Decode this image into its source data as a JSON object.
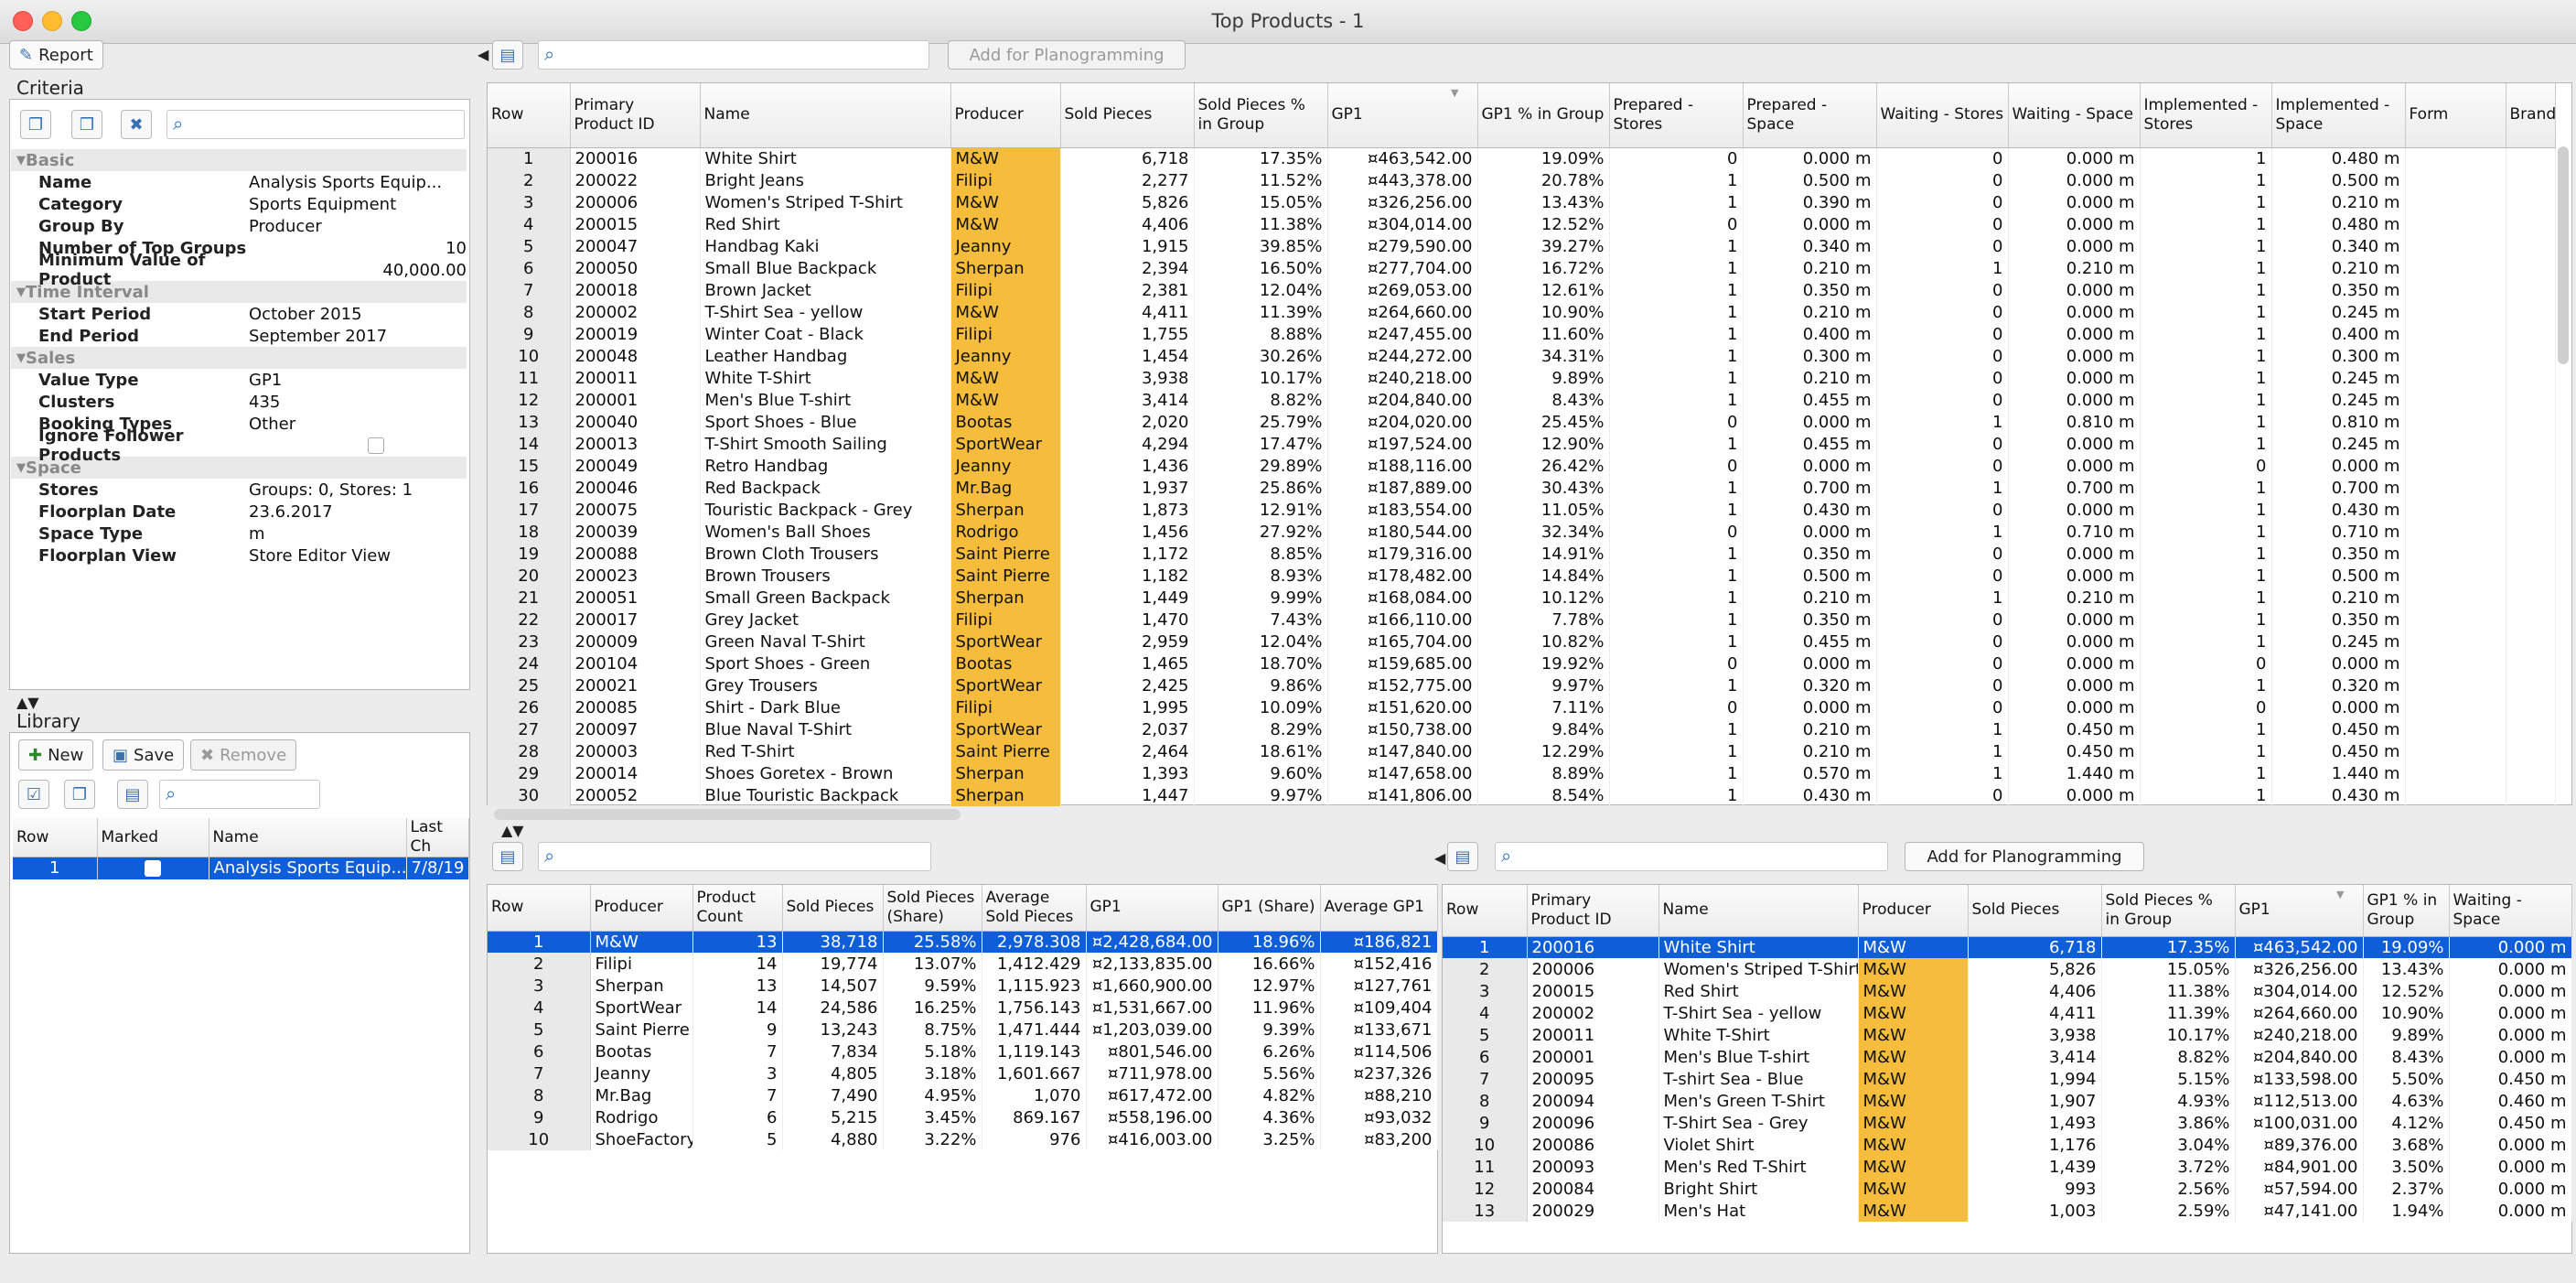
{
  "window": {
    "title": "Top Products - 1"
  },
  "toolbar": {
    "report": "Report"
  },
  "criteria": {
    "title": "Criteria",
    "groups": [
      {
        "name": "Basic",
        "rows": [
          [
            "Name",
            "Analysis Sports Equip..."
          ],
          [
            "Category",
            "Sports Equipment"
          ],
          [
            "Group By",
            "Producer"
          ],
          [
            "Number of Top Groups",
            "10"
          ],
          [
            "Minimum Value of Product",
            "40,000.00"
          ]
        ]
      },
      {
        "name": "Time Interval",
        "rows": [
          [
            "Start Period",
            "October 2015"
          ],
          [
            "End Period",
            "September 2017"
          ]
        ]
      },
      {
        "name": "Sales",
        "rows": [
          [
            "Value Type",
            "GP1"
          ],
          [
            "Clusters",
            "435"
          ],
          [
            "Booking Types",
            "Other"
          ],
          [
            "Ignore Follower Products",
            ""
          ]
        ]
      },
      {
        "name": "Space",
        "rows": [
          [
            "Stores",
            "Groups: 0, Stores: 1"
          ],
          [
            "Floorplan Date",
            "23.6.2017"
          ],
          [
            "Space Type",
            "m"
          ],
          [
            "Floorplan View",
            "Store Editor View"
          ]
        ]
      }
    ]
  },
  "library": {
    "title": "Library",
    "new": "New",
    "save": "Save",
    "remove": "Remove",
    "headers": [
      "Row",
      "Marked",
      "Name",
      "Last Ch"
    ],
    "rows": [
      [
        "1",
        "",
        "Analysis Sports Equip...",
        "7/8/19"
      ]
    ]
  },
  "main": {
    "add_button": "Add for Planogramming",
    "sort_indicator": "1",
    "headers": [
      "Row",
      "Primary Product ID",
      "Name",
      "Producer",
      "Sold Pieces",
      "Sold Pieces % in Group",
      "GP1",
      "GP1 % in Group",
      "Prepared - Stores",
      "Prepared - Space",
      "Waiting - Stores",
      "Waiting - Space",
      "Implemented - Stores",
      "Implemented - Space",
      "Form",
      "Brand"
    ],
    "rows": [
      [
        "1",
        "200016",
        "White Shirt",
        "M&W",
        "6,718",
        "17.35%",
        "¤463,542.00",
        "19.09%",
        "0",
        "0.000 m",
        "0",
        "0.000 m",
        "1",
        "0.480 m"
      ],
      [
        "2",
        "200022",
        "Bright Jeans",
        "Filipi",
        "2,277",
        "11.52%",
        "¤443,378.00",
        "20.78%",
        "1",
        "0.500 m",
        "0",
        "0.000 m",
        "1",
        "0.500 m"
      ],
      [
        "3",
        "200006",
        "Women's Striped T-Shirt",
        "M&W",
        "5,826",
        "15.05%",
        "¤326,256.00",
        "13.43%",
        "1",
        "0.390 m",
        "0",
        "0.000 m",
        "1",
        "0.210 m"
      ],
      [
        "4",
        "200015",
        "Red Shirt",
        "M&W",
        "4,406",
        "11.38%",
        "¤304,014.00",
        "12.52%",
        "0",
        "0.000 m",
        "0",
        "0.000 m",
        "1",
        "0.480 m"
      ],
      [
        "5",
        "200047",
        "Handbag Kaki",
        "Jeanny",
        "1,915",
        "39.85%",
        "¤279,590.00",
        "39.27%",
        "1",
        "0.340 m",
        "0",
        "0.000 m",
        "1",
        "0.340 m"
      ],
      [
        "6",
        "200050",
        "Small Blue Backpack",
        "Sherpan",
        "2,394",
        "16.50%",
        "¤277,704.00",
        "16.72%",
        "1",
        "0.210 m",
        "1",
        "0.210 m",
        "1",
        "0.210 m"
      ],
      [
        "7",
        "200018",
        "Brown Jacket",
        "Filipi",
        "2,381",
        "12.04%",
        "¤269,053.00",
        "12.61%",
        "1",
        "0.350 m",
        "0",
        "0.000 m",
        "1",
        "0.350 m"
      ],
      [
        "8",
        "200002",
        "T-Shirt Sea - yellow",
        "M&W",
        "4,411",
        "11.39%",
        "¤264,660.00",
        "10.90%",
        "1",
        "0.210 m",
        "0",
        "0.000 m",
        "1",
        "0.245 m"
      ],
      [
        "9",
        "200019",
        "Winter Coat - Black",
        "Filipi",
        "1,755",
        "8.88%",
        "¤247,455.00",
        "11.60%",
        "1",
        "0.400 m",
        "0",
        "0.000 m",
        "1",
        "0.400 m"
      ],
      [
        "10",
        "200048",
        "Leather Handbag",
        "Jeanny",
        "1,454",
        "30.26%",
        "¤244,272.00",
        "34.31%",
        "1",
        "0.300 m",
        "0",
        "0.000 m",
        "1",
        "0.300 m"
      ],
      [
        "11",
        "200011",
        "White T-Shirt",
        "M&W",
        "3,938",
        "10.17%",
        "¤240,218.00",
        "9.89%",
        "1",
        "0.210 m",
        "0",
        "0.000 m",
        "1",
        "0.245 m"
      ],
      [
        "12",
        "200001",
        "Men's Blue T-shirt",
        "M&W",
        "3,414",
        "8.82%",
        "¤204,840.00",
        "8.43%",
        "1",
        "0.455 m",
        "0",
        "0.000 m",
        "1",
        "0.245 m"
      ],
      [
        "13",
        "200040",
        "Sport Shoes - Blue",
        "Bootas",
        "2,020",
        "25.79%",
        "¤204,020.00",
        "25.45%",
        "0",
        "0.000 m",
        "1",
        "0.810 m",
        "1",
        "0.810 m"
      ],
      [
        "14",
        "200013",
        "T-Shirt Smooth Sailing",
        "SportWear",
        "4,294",
        "17.47%",
        "¤197,524.00",
        "12.90%",
        "1",
        "0.455 m",
        "0",
        "0.000 m",
        "1",
        "0.245 m"
      ],
      [
        "15",
        "200049",
        "Retro Handbag",
        "Jeanny",
        "1,436",
        "29.89%",
        "¤188,116.00",
        "26.42%",
        "0",
        "0.000 m",
        "0",
        "0.000 m",
        "0",
        "0.000 m"
      ],
      [
        "16",
        "200046",
        "Red Backpack",
        "Mr.Bag",
        "1,937",
        "25.86%",
        "¤187,889.00",
        "30.43%",
        "1",
        "0.700 m",
        "1",
        "0.700 m",
        "1",
        "0.700 m"
      ],
      [
        "17",
        "200075",
        "Touristic Backpack - Grey",
        "Sherpan",
        "1,873",
        "12.91%",
        "¤183,554.00",
        "11.05%",
        "1",
        "0.430 m",
        "0",
        "0.000 m",
        "1",
        "0.430 m"
      ],
      [
        "18",
        "200039",
        "Women's Ball Shoes",
        "Rodrigo",
        "1,456",
        "27.92%",
        "¤180,544.00",
        "32.34%",
        "0",
        "0.000 m",
        "1",
        "0.710 m",
        "1",
        "0.710 m"
      ],
      [
        "19",
        "200088",
        "Brown Cloth Trousers",
        "Saint Pierre",
        "1,172",
        "8.85%",
        "¤179,316.00",
        "14.91%",
        "1",
        "0.350 m",
        "0",
        "0.000 m",
        "1",
        "0.350 m"
      ],
      [
        "20",
        "200023",
        "Brown Trousers",
        "Saint Pierre",
        "1,182",
        "8.93%",
        "¤178,482.00",
        "14.84%",
        "1",
        "0.500 m",
        "0",
        "0.000 m",
        "1",
        "0.500 m"
      ],
      [
        "21",
        "200051",
        "Small Green Backpack",
        "Sherpan",
        "1,449",
        "9.99%",
        "¤168,084.00",
        "10.12%",
        "1",
        "0.210 m",
        "1",
        "0.210 m",
        "1",
        "0.210 m"
      ],
      [
        "22",
        "200017",
        "Grey Jacket",
        "Filipi",
        "1,470",
        "7.43%",
        "¤166,110.00",
        "7.78%",
        "1",
        "0.350 m",
        "0",
        "0.000 m",
        "1",
        "0.350 m"
      ],
      [
        "23",
        "200009",
        "Green Naval T-Shirt",
        "SportWear",
        "2,959",
        "12.04%",
        "¤165,704.00",
        "10.82%",
        "1",
        "0.455 m",
        "0",
        "0.000 m",
        "1",
        "0.245 m"
      ],
      [
        "24",
        "200104",
        "Sport Shoes - Green",
        "Bootas",
        "1,465",
        "18.70%",
        "¤159,685.00",
        "19.92%",
        "0",
        "0.000 m",
        "0",
        "0.000 m",
        "0",
        "0.000 m"
      ],
      [
        "25",
        "200021",
        "Grey Trousers",
        "SportWear",
        "2,425",
        "9.86%",
        "¤152,775.00",
        "9.97%",
        "1",
        "0.320 m",
        "0",
        "0.000 m",
        "1",
        "0.320 m"
      ],
      [
        "26",
        "200085",
        "Shirt - Dark Blue",
        "Filipi",
        "1,995",
        "10.09%",
        "¤151,620.00",
        "7.11%",
        "0",
        "0.000 m",
        "0",
        "0.000 m",
        "0",
        "0.000 m"
      ],
      [
        "27",
        "200097",
        "Blue Naval T-Shirt",
        "SportWear",
        "2,037",
        "8.29%",
        "¤150,738.00",
        "9.84%",
        "1",
        "0.210 m",
        "1",
        "0.450 m",
        "1",
        "0.450 m"
      ],
      [
        "28",
        "200003",
        "Red T-Shirt",
        "Saint Pierre",
        "2,464",
        "18.61%",
        "¤147,840.00",
        "12.29%",
        "1",
        "0.210 m",
        "1",
        "0.450 m",
        "1",
        "0.450 m"
      ],
      [
        "29",
        "200014",
        "Shoes Goretex - Brown",
        "Sherpan",
        "1,393",
        "9.60%",
        "¤147,658.00",
        "8.89%",
        "1",
        "0.570 m",
        "1",
        "1.440 m",
        "1",
        "1.440 m"
      ],
      [
        "30",
        "200052",
        "Blue Touristic Backpack",
        "Sherpan",
        "1,447",
        "9.97%",
        "¤141,806.00",
        "8.54%",
        "1",
        "0.430 m",
        "0",
        "0.000 m",
        "1",
        "0.430 m"
      ]
    ]
  },
  "groups": {
    "headers": [
      "Row",
      "Producer",
      "Product Count",
      "Sold Pieces",
      "Sold Pieces (Share)",
      "Average Sold Pieces",
      "GP1",
      "GP1 (Share)",
      "Average GP1"
    ],
    "rows": [
      [
        "1",
        "M&W",
        "13",
        "38,718",
        "25.58%",
        "2,978.308",
        "¤2,428,684.00",
        "18.96%",
        "¤186,821"
      ],
      [
        "2",
        "Filipi",
        "14",
        "19,774",
        "13.07%",
        "1,412.429",
        "¤2,133,835.00",
        "16.66%",
        "¤152,416"
      ],
      [
        "3",
        "Sherpan",
        "13",
        "14,507",
        "9.59%",
        "1,115.923",
        "¤1,660,900.00",
        "12.97%",
        "¤127,761"
      ],
      [
        "4",
        "SportWear",
        "14",
        "24,586",
        "16.25%",
        "1,756.143",
        "¤1,531,667.00",
        "11.96%",
        "¤109,404"
      ],
      [
        "5",
        "Saint Pierre",
        "9",
        "13,243",
        "8.75%",
        "1,471.444",
        "¤1,203,039.00",
        "9.39%",
        "¤133,671"
      ],
      [
        "6",
        "Bootas",
        "7",
        "7,834",
        "5.18%",
        "1,119.143",
        "¤801,546.00",
        "6.26%",
        "¤114,506"
      ],
      [
        "7",
        "Jeanny",
        "3",
        "4,805",
        "3.18%",
        "1,601.667",
        "¤711,978.00",
        "5.56%",
        "¤237,326"
      ],
      [
        "8",
        "Mr.Bag",
        "7",
        "7,490",
        "4.95%",
        "1,070",
        "¤617,472.00",
        "4.82%",
        "¤88,210"
      ],
      [
        "9",
        "Rodrigo",
        "6",
        "5,215",
        "3.45%",
        "869.167",
        "¤558,196.00",
        "4.36%",
        "¤93,032"
      ],
      [
        "10",
        "ShoeFactory",
        "5",
        "4,880",
        "3.22%",
        "976",
        "¤416,003.00",
        "3.25%",
        "¤83,200"
      ]
    ]
  },
  "detail": {
    "add_button": "Add for Planogramming",
    "sort_indicator": "1",
    "headers": [
      "Row",
      "Primary Product ID",
      "Name",
      "Producer",
      "Sold Pieces",
      "Sold Pieces % in Group",
      "GP1",
      "GP1 % in Group",
      "Waiting - Space"
    ],
    "rows": [
      [
        "1",
        "200016",
        "White Shirt",
        "M&W",
        "6,718",
        "17.35%",
        "¤463,542.00",
        "19.09%",
        "0.000 m"
      ],
      [
        "2",
        "200006",
        "Women's Striped T-Shirt",
        "M&W",
        "5,826",
        "15.05%",
        "¤326,256.00",
        "13.43%",
        "0.000 m"
      ],
      [
        "3",
        "200015",
        "Red Shirt",
        "M&W",
        "4,406",
        "11.38%",
        "¤304,014.00",
        "12.52%",
        "0.000 m"
      ],
      [
        "4",
        "200002",
        "T-Shirt Sea - yellow",
        "M&W",
        "4,411",
        "11.39%",
        "¤264,660.00",
        "10.90%",
        "0.000 m"
      ],
      [
        "5",
        "200011",
        "White T-Shirt",
        "M&W",
        "3,938",
        "10.17%",
        "¤240,218.00",
        "9.89%",
        "0.000 m"
      ],
      [
        "6",
        "200001",
        "Men's Blue T-shirt",
        "M&W",
        "3,414",
        "8.82%",
        "¤204,840.00",
        "8.43%",
        "0.000 m"
      ],
      [
        "7",
        "200095",
        "T-shirt Sea - Blue",
        "M&W",
        "1,994",
        "5.15%",
        "¤133,598.00",
        "5.50%",
        "0.450 m"
      ],
      [
        "8",
        "200094",
        "Men's Green T-Shirt",
        "M&W",
        "1,907",
        "4.93%",
        "¤112,513.00",
        "4.63%",
        "0.460 m"
      ],
      [
        "9",
        "200096",
        "T-Shirt Sea - Grey",
        "M&W",
        "1,493",
        "3.86%",
        "¤100,031.00",
        "4.12%",
        "0.450 m"
      ],
      [
        "10",
        "200086",
        "Violet Shirt",
        "M&W",
        "1,176",
        "3.04%",
        "¤89,376.00",
        "3.68%",
        "0.000 m"
      ],
      [
        "11",
        "200093",
        "Men's Red T-Shirt",
        "M&W",
        "1,439",
        "3.72%",
        "¤84,901.00",
        "3.50%",
        "0.000 m"
      ],
      [
        "12",
        "200084",
        "Bright Shirt",
        "M&W",
        "993",
        "2.56%",
        "¤57,594.00",
        "2.37%",
        "0.000 m"
      ],
      [
        "13",
        "200029",
        "Men's Hat",
        "M&W",
        "1,003",
        "2.59%",
        "¤47,141.00",
        "1.94%",
        "0.000 m"
      ]
    ]
  },
  "colors": {
    "producer_highlight": "#f6bd3c",
    "selection": "#0d5ed8"
  }
}
